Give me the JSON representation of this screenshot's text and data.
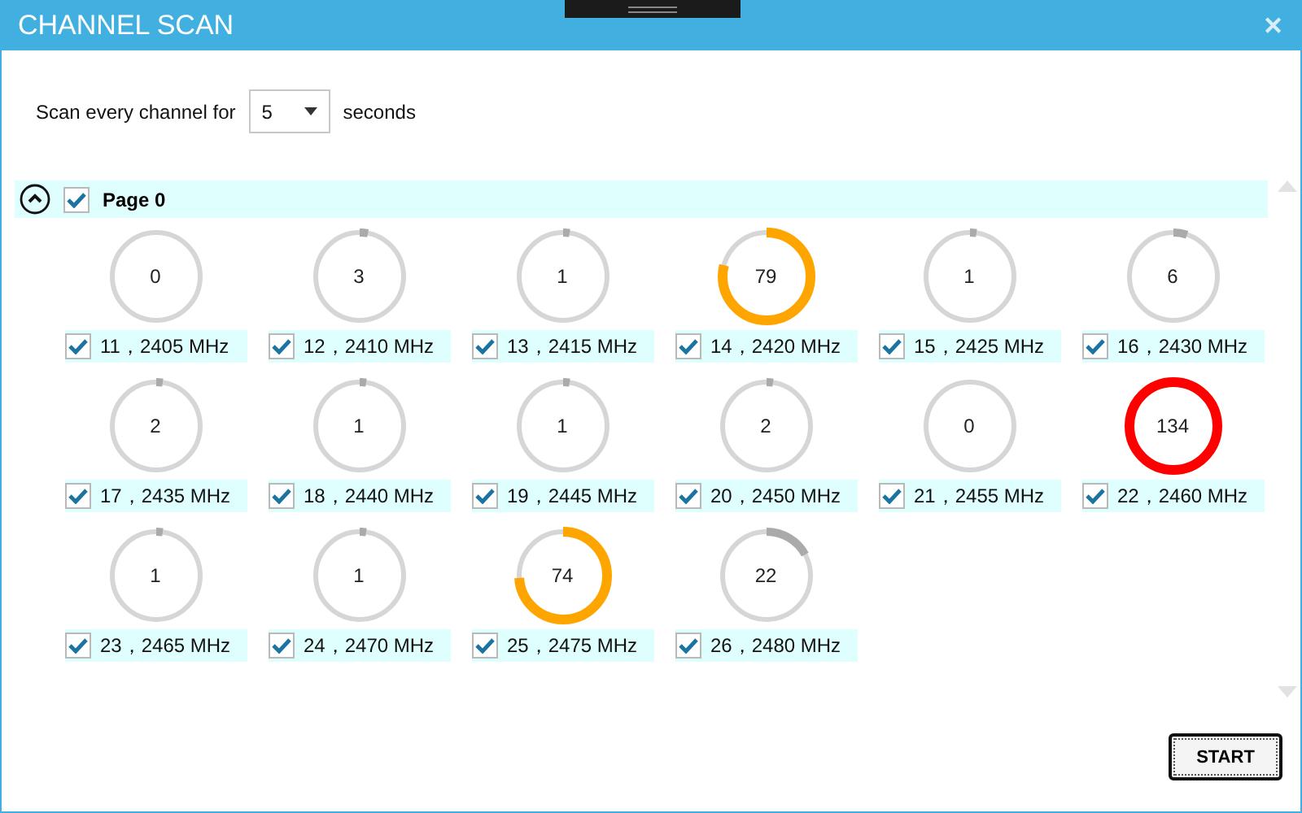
{
  "window": {
    "title": "CHANNEL SCAN",
    "close": "✕"
  },
  "scan": {
    "label": "Scan every channel for",
    "duration": "5",
    "unit": "seconds"
  },
  "page": {
    "label": "Page 0",
    "checked": true,
    "expanded": true
  },
  "channels": [
    {
      "label": "11，2405 MHz",
      "checked": true,
      "value": "0",
      "level": 0
    },
    {
      "label": "12，2410 MHz",
      "checked": true,
      "value": "3",
      "level": 0.03,
      "color": "#aaaaaa"
    },
    {
      "label": "13，2415 MHz",
      "checked": true,
      "value": "1",
      "level": 0.01,
      "color": "#aaaaaa"
    },
    {
      "label": "14，2420 MHz",
      "checked": true,
      "value": "79",
      "level": 0.79,
      "color": "#ffa500"
    },
    {
      "label": "15，2425 MHz",
      "checked": true,
      "value": "1",
      "level": 0.01,
      "color": "#aaaaaa"
    },
    {
      "label": "16，2430 MHz",
      "checked": true,
      "value": "6",
      "level": 0.05,
      "color": "#aaaaaa"
    },
    {
      "label": "17，2435 MHz",
      "checked": true,
      "value": "2",
      "level": 0.02,
      "color": "#aaaaaa"
    },
    {
      "label": "18，2440 MHz",
      "checked": true,
      "value": "1",
      "level": 0.01,
      "color": "#aaaaaa"
    },
    {
      "label": "19，2445 MHz",
      "checked": true,
      "value": "1",
      "level": 0.01,
      "color": "#aaaaaa"
    },
    {
      "label": "20，2450 MHz",
      "checked": true,
      "value": "2",
      "level": 0.02,
      "color": "#aaaaaa"
    },
    {
      "label": "21，2455 MHz",
      "checked": true,
      "value": "0",
      "level": 0
    },
    {
      "label": "22，2460 MHz",
      "checked": true,
      "value": "134",
      "level": 1,
      "color": "#ff0000"
    },
    {
      "label": "23，2465 MHz",
      "checked": true,
      "value": "1",
      "level": 0.01,
      "color": "#aaaaaa"
    },
    {
      "label": "24，2470 MHz",
      "checked": true,
      "value": "1",
      "level": 0.01,
      "color": "#aaaaaa"
    },
    {
      "label": "25，2475 MHz",
      "checked": true,
      "value": "74",
      "level": 0.74,
      "color": "#ffa500"
    },
    {
      "label": "26，2480 MHz",
      "checked": true,
      "value": "22",
      "level": 0.17,
      "color": "#aaaaaa"
    }
  ],
  "buttons": [
    {
      "label": "START"
    }
  ]
}
